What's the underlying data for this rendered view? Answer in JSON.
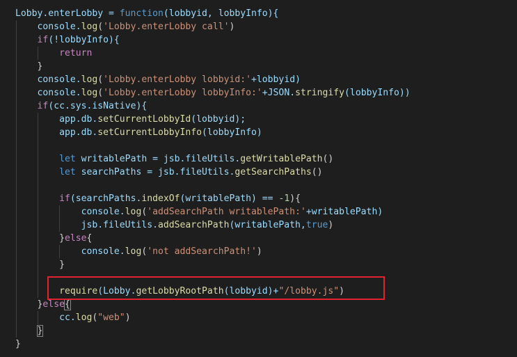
{
  "colors": {
    "background": "#1e1e1e",
    "default": "#d4d4d4",
    "keyword": "#569cd6",
    "control": "#c586c0",
    "function": "#dcdcaa",
    "variable": "#9cdcfe",
    "string": "#ce9178",
    "number": "#b5cea8",
    "highlight": "#e0232e"
  },
  "code_lines": [
    [
      {
        "t": "Lobby.enterLobby = ",
        "c": "variable"
      },
      {
        "t": "function",
        "c": "keyword"
      },
      {
        "t": "(lobbyid, lobbyInfo){",
        "c": "variable"
      }
    ],
    [
      {
        "t": "    console.",
        "c": "variable"
      },
      {
        "t": "log",
        "c": "function"
      },
      {
        "t": "(",
        "c": "default"
      },
      {
        "t": "'Lobby.enterLobby call'",
        "c": "string"
      },
      {
        "t": ")",
        "c": "default"
      }
    ],
    [
      {
        "t": "    ",
        "c": "default"
      },
      {
        "t": "if",
        "c": "control"
      },
      {
        "t": "(!lobbyInfo){",
        "c": "variable"
      }
    ],
    [
      {
        "t": "        ",
        "c": "default"
      },
      {
        "t": "return",
        "c": "control"
      }
    ],
    [
      {
        "t": "    }",
        "c": "default"
      }
    ],
    [
      {
        "t": "    console.",
        "c": "variable"
      },
      {
        "t": "log",
        "c": "function"
      },
      {
        "t": "(",
        "c": "default"
      },
      {
        "t": "'Lobby.enterLobby lobbyid:'",
        "c": "string"
      },
      {
        "t": "+lobbyid)",
        "c": "variable"
      }
    ],
    [
      {
        "t": "    console.",
        "c": "variable"
      },
      {
        "t": "log",
        "c": "function"
      },
      {
        "t": "(",
        "c": "default"
      },
      {
        "t": "'Lobby.enterLobby lobbyInfo:'",
        "c": "string"
      },
      {
        "t": "+JSON.",
        "c": "variable"
      },
      {
        "t": "stringify",
        "c": "function"
      },
      {
        "t": "(lobbyInfo))",
        "c": "variable"
      }
    ],
    [
      {
        "t": "    ",
        "c": "default"
      },
      {
        "t": "if",
        "c": "control"
      },
      {
        "t": "(cc.sys.isNative){",
        "c": "variable"
      }
    ],
    [
      {
        "t": "        app.db.",
        "c": "variable"
      },
      {
        "t": "setCurrentLobbyId",
        "c": "function"
      },
      {
        "t": "(lobbyid);",
        "c": "variable"
      }
    ],
    [
      {
        "t": "        app.db.",
        "c": "variable"
      },
      {
        "t": "setCurrentLobbyInfo",
        "c": "function"
      },
      {
        "t": "(lobbyInfo)",
        "c": "variable"
      }
    ],
    [],
    [
      {
        "t": "        ",
        "c": "default"
      },
      {
        "t": "let",
        "c": "keyword"
      },
      {
        "t": " writablePath = jsb.fileUtils.",
        "c": "variable"
      },
      {
        "t": "getWritablePath",
        "c": "function"
      },
      {
        "t": "()",
        "c": "default"
      }
    ],
    [
      {
        "t": "        ",
        "c": "default"
      },
      {
        "t": "let",
        "c": "keyword"
      },
      {
        "t": " searchPaths = jsb.fileUtils.",
        "c": "variable"
      },
      {
        "t": "getSearchPaths",
        "c": "function"
      },
      {
        "t": "()",
        "c": "default"
      }
    ],
    [],
    [
      {
        "t": "        ",
        "c": "default"
      },
      {
        "t": "if",
        "c": "control"
      },
      {
        "t": "(searchPaths.",
        "c": "variable"
      },
      {
        "t": "indexOf",
        "c": "function"
      },
      {
        "t": "(writablePath) == ",
        "c": "variable"
      },
      {
        "t": "-1",
        "c": "number"
      },
      {
        "t": "){",
        "c": "default"
      }
    ],
    [
      {
        "t": "            console.",
        "c": "variable"
      },
      {
        "t": "log",
        "c": "function"
      },
      {
        "t": "(",
        "c": "default"
      },
      {
        "t": "'addSearchPath writablePath:'",
        "c": "string"
      },
      {
        "t": "+writablePath)",
        "c": "variable"
      }
    ],
    [
      {
        "t": "            jsb.fileUtils.",
        "c": "variable"
      },
      {
        "t": "addSearchPath",
        "c": "function"
      },
      {
        "t": "(writablePath,",
        "c": "variable"
      },
      {
        "t": "true",
        "c": "keyword"
      },
      {
        "t": ")",
        "c": "default"
      }
    ],
    [
      {
        "t": "        }",
        "c": "default"
      },
      {
        "t": "else",
        "c": "control"
      },
      {
        "t": "{",
        "c": "default"
      }
    ],
    [
      {
        "t": "            console.",
        "c": "variable"
      },
      {
        "t": "log",
        "c": "function"
      },
      {
        "t": "(",
        "c": "default"
      },
      {
        "t": "'not addSearchPath!'",
        "c": "string"
      },
      {
        "t": ")",
        "c": "default"
      }
    ],
    [
      {
        "t": "        }",
        "c": "default"
      }
    ],
    [],
    [
      {
        "t": "        ",
        "c": "default"
      },
      {
        "t": "require",
        "c": "function"
      },
      {
        "t": "(Lobby.",
        "c": "variable"
      },
      {
        "t": "getLobbyRootPath",
        "c": "function"
      },
      {
        "t": "(lobbyid)+",
        "c": "variable"
      },
      {
        "t": "\"/lobby.js\"",
        "c": "string"
      },
      {
        "t": ")",
        "c": "default"
      }
    ],
    [
      {
        "t": "    }",
        "c": "default"
      },
      {
        "t": "else",
        "c": "control"
      },
      {
        "t": "{",
        "c": "default",
        "match": true
      }
    ],
    [
      {
        "t": "        cc.",
        "c": "variable"
      },
      {
        "t": "log",
        "c": "function"
      },
      {
        "t": "(",
        "c": "default"
      },
      {
        "t": "\"web\"",
        "c": "string"
      },
      {
        "t": ")",
        "c": "default"
      }
    ],
    [
      {
        "t": "    ",
        "c": "default"
      },
      {
        "t": "}",
        "c": "default",
        "match": true
      }
    ],
    [
      {
        "t": "}",
        "c": "default"
      }
    ]
  ]
}
